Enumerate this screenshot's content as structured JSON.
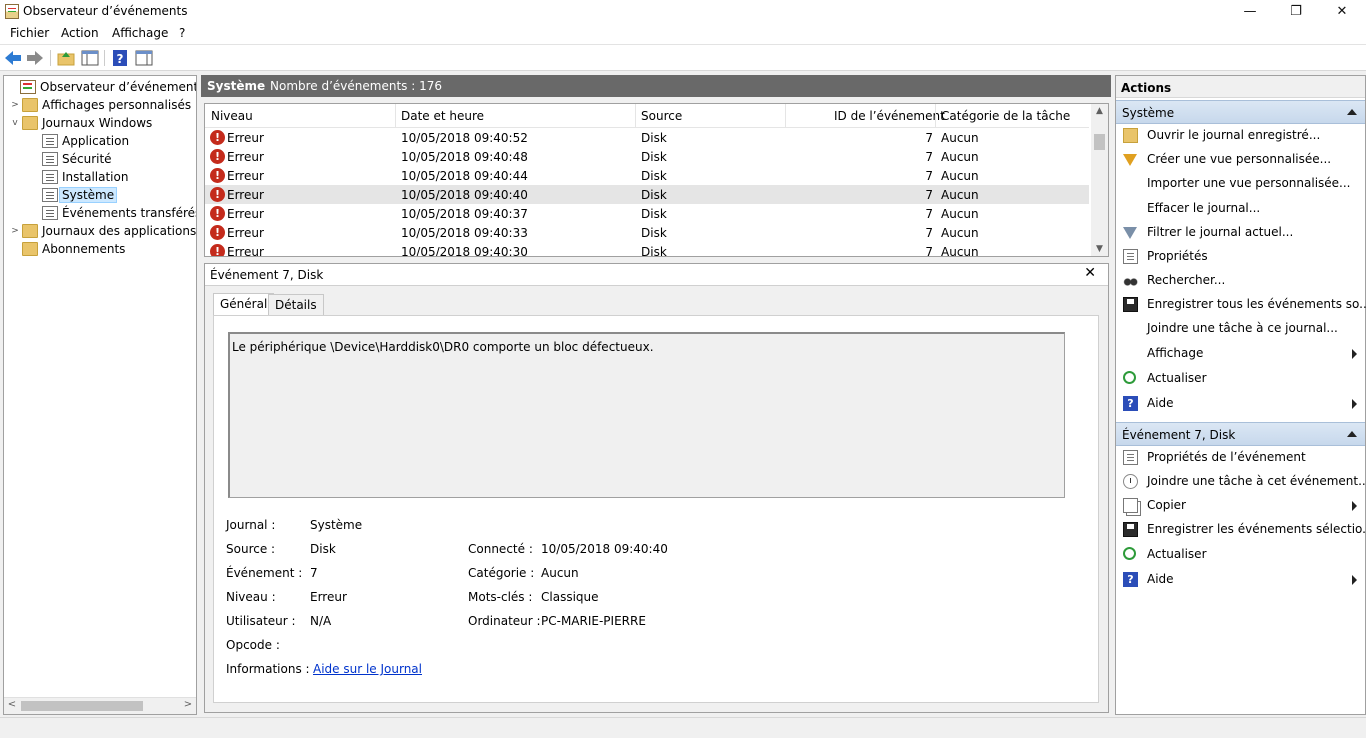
{
  "window": {
    "title": "Observateur d’événements",
    "minimize": "—",
    "maximize": "❐",
    "close": "✕"
  },
  "menu": [
    "Fichier",
    "Action",
    "Affichage",
    "?"
  ],
  "toolbar": {
    "back_icon": "arrow-left-icon",
    "forward_icon": "arrow-right-icon",
    "help_glyph": "?"
  },
  "tree": {
    "root": "Observateur d’événements (Local)",
    "custom_views": "Affichages personnalisés",
    "windows_logs": "Journaux Windows",
    "application": "Application",
    "security": "Sécurité",
    "setup": "Installation",
    "system": "Système",
    "forwarded": "Événements transférés",
    "apps_services": "Journaux des applications et",
    "subscriptions": "Abonnements"
  },
  "middle": {
    "header_title": "Système",
    "header_count": "Nombre d’événements : 176",
    "columns": [
      "Niveau",
      "Date et heure",
      "Source",
      "ID de l’événement",
      "Catégorie de la tâche"
    ],
    "rows": [
      {
        "level": "Erreur",
        "date": "10/05/2018 09:40:52",
        "source": "Disk",
        "id": "7",
        "category": "Aucun"
      },
      {
        "level": "Erreur",
        "date": "10/05/2018 09:40:48",
        "source": "Disk",
        "id": "7",
        "category": "Aucun"
      },
      {
        "level": "Erreur",
        "date": "10/05/2018 09:40:44",
        "source": "Disk",
        "id": "7",
        "category": "Aucun"
      },
      {
        "level": "Erreur",
        "date": "10/05/2018 09:40:40",
        "source": "Disk",
        "id": "7",
        "category": "Aucun"
      },
      {
        "level": "Erreur",
        "date": "10/05/2018 09:40:37",
        "source": "Disk",
        "id": "7",
        "category": "Aucun"
      },
      {
        "level": "Erreur",
        "date": "10/05/2018 09:40:33",
        "source": "Disk",
        "id": "7",
        "category": "Aucun"
      },
      {
        "level": "Erreur",
        "date": "10/05/2018 09:40:30",
        "source": "Disk",
        "id": "7",
        "category": "Aucun"
      }
    ],
    "selected_row": 3
  },
  "detail": {
    "title": "Événement 7, Disk",
    "close": "✕",
    "tabs": [
      "Général",
      "Détails"
    ],
    "message": "Le périphérique \\Device\\Harddisk0\\DR0 comporte un bloc défectueux.",
    "fields": {
      "journal_label": "Journal :",
      "journal_value": "Système",
      "source_label": "Source :",
      "source_value": "Disk",
      "event_label": "Événement :",
      "event_value": "7",
      "level_label": "Niveau :",
      "level_value": "Erreur",
      "user_label": "Utilisateur :",
      "user_value": "N/A",
      "opcode_label": "Opcode :",
      "info_label": "Informations :",
      "info_link": "Aide sur le Journal",
      "connected_label": "Connecté :",
      "connected_value": "10/05/2018 09:40:40",
      "category_label": "Catégorie :",
      "category_value": "Aucun",
      "keywords_label": "Mots-clés :",
      "keywords_value": "Classique",
      "computer_label": "Ordinateur :",
      "computer_value": "PC-MARIE-PIERRE"
    }
  },
  "actions": {
    "title": "Actions",
    "section1": "Système",
    "items1": [
      "Ouvrir le journal enregistré...",
      "Créer une vue personnalisée...",
      "Importer une vue personnalisée...",
      "Effacer le journal...",
      "Filtrer le journal actuel...",
      "Propriétés",
      "Rechercher...",
      "Enregistrer tous les événements so...",
      "Joindre une tâche à ce journal...",
      "Affichage",
      "Actualiser",
      "Aide"
    ],
    "section2": "Événement 7, Disk",
    "items2": [
      "Propriétés de l’événement",
      "Joindre une tâche à cet événement...",
      "Copier",
      "Enregistrer les événements sélectio...",
      "Actualiser",
      "Aide"
    ]
  }
}
